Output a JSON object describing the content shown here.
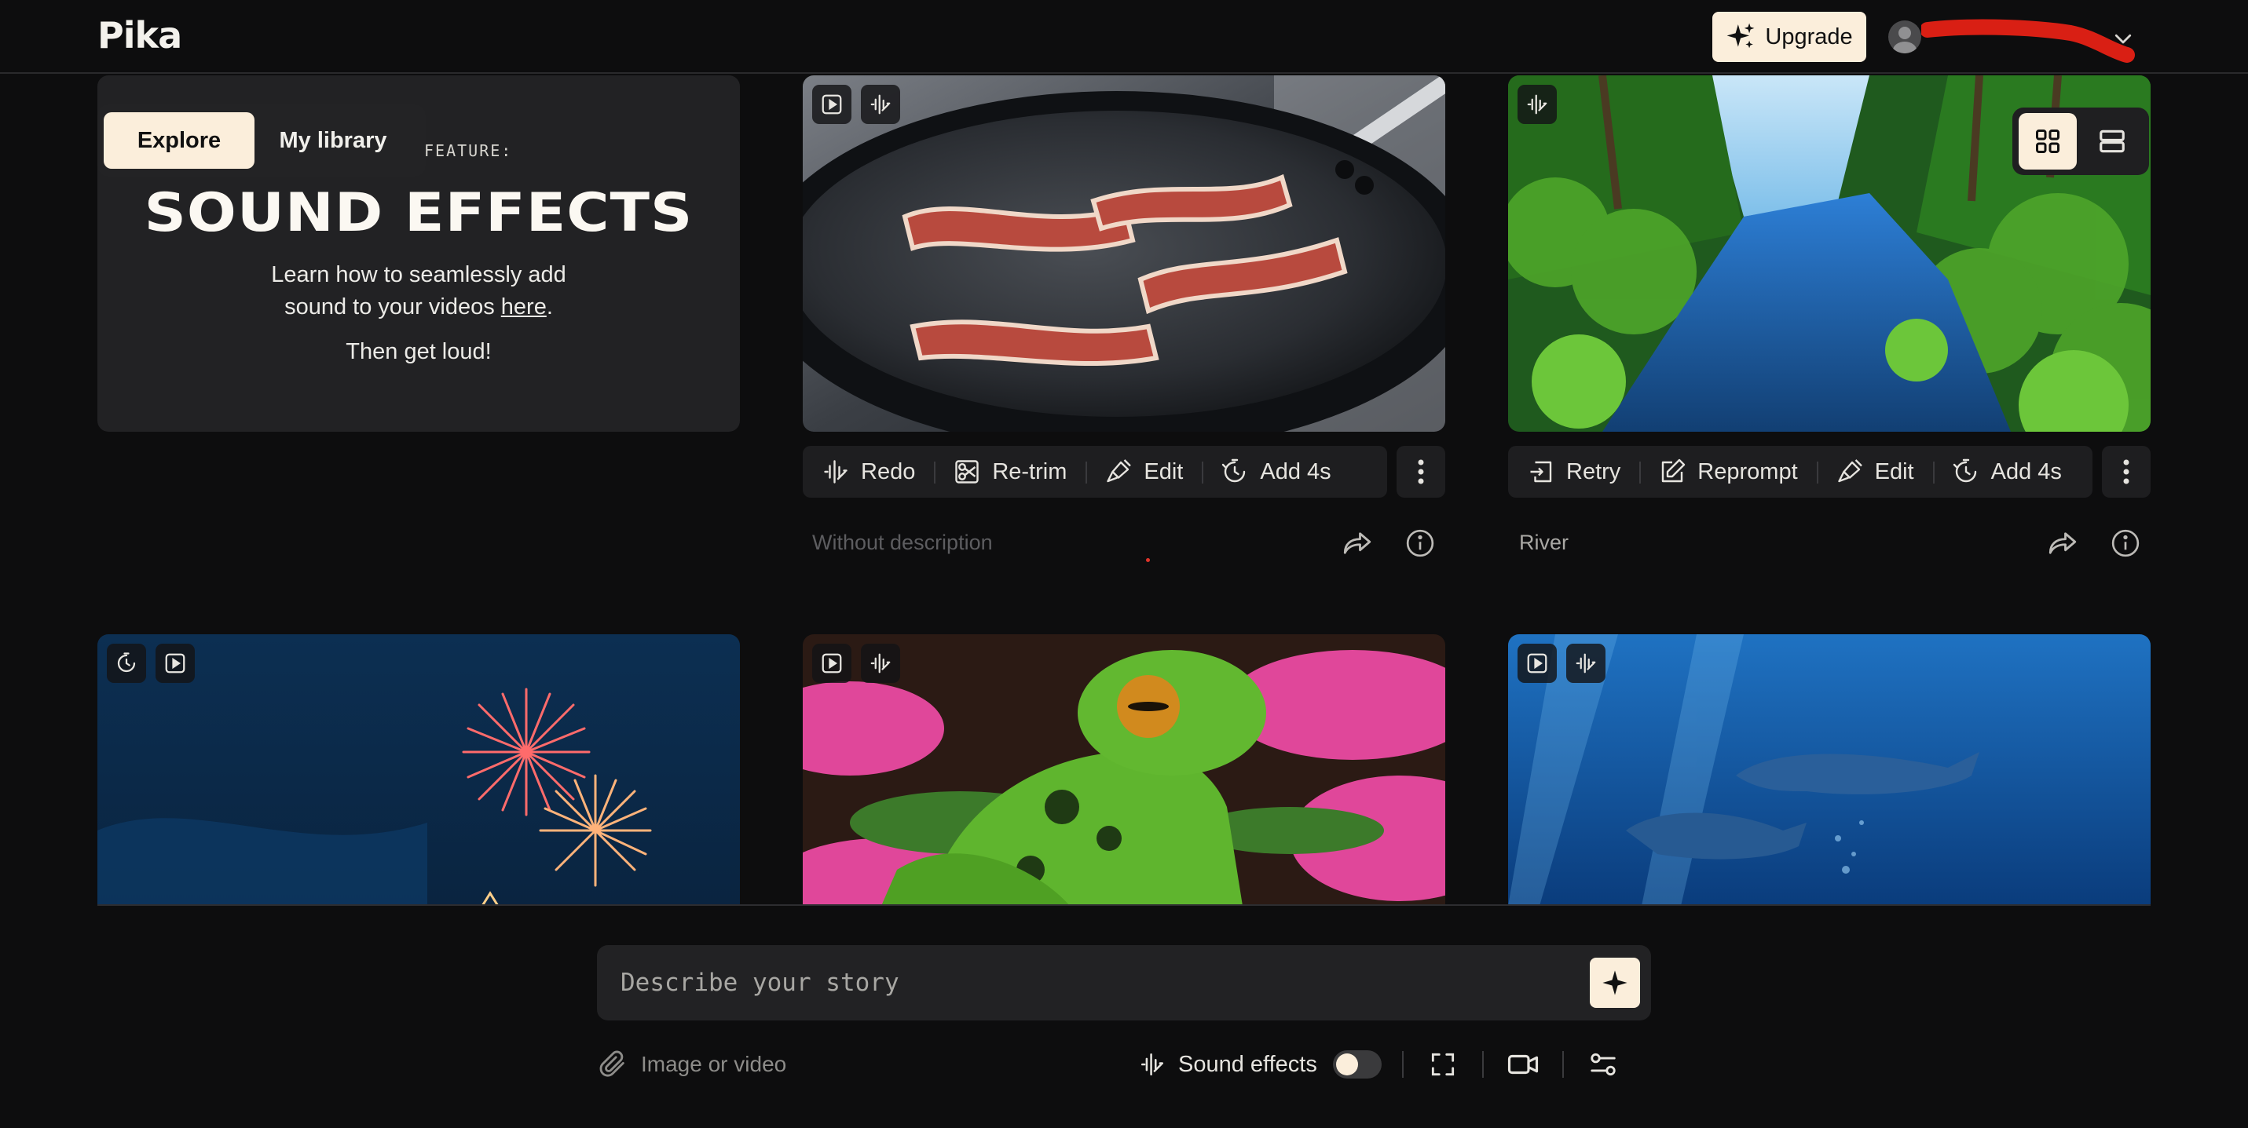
{
  "header": {
    "logo": "Pika",
    "upgrade_label": "Upgrade"
  },
  "tabs": [
    {
      "label": "Explore",
      "active": true
    },
    {
      "label": "My library",
      "active": false
    }
  ],
  "view_toggle": {
    "active": "grid"
  },
  "feature_card": {
    "kicker": "FEATURE:",
    "title": "SOUND EFFECTS",
    "body_line1": "Learn how to seamlessly add",
    "body_line2_prefix": "sound to your videos ",
    "body_link": "here",
    "body_line2_suffix": ".",
    "footer": "Then get loud!"
  },
  "cards": [
    {
      "id": "bacon",
      "badges": [
        "play-icon",
        "sound-wave-icon"
      ],
      "actions": [
        {
          "icon": "sound-wave-icon",
          "label": "Redo"
        },
        {
          "icon": "scissors-icon",
          "label": "Re-trim"
        },
        {
          "icon": "brush-icon",
          "label": "Edit"
        },
        {
          "icon": "timer-icon",
          "label": "Add 4s"
        }
      ],
      "description": "Without description"
    },
    {
      "id": "river",
      "badges": [
        "sound-wave-icon"
      ],
      "actions": [
        {
          "icon": "retry-icon",
          "label": "Retry"
        },
        {
          "icon": "pencil-square-icon",
          "label": "Reprompt"
        },
        {
          "icon": "brush-icon",
          "label": "Edit"
        },
        {
          "icon": "timer-icon",
          "label": "Add 4s"
        }
      ],
      "description": "River"
    },
    {
      "id": "fireworks",
      "badges": [
        "timer-icon",
        "play-icon"
      ]
    },
    {
      "id": "frog",
      "badges": [
        "play-icon",
        "sound-wave-icon"
      ]
    },
    {
      "id": "dolphins",
      "badges": [
        "play-icon",
        "sound-wave-icon"
      ]
    }
  ],
  "composer": {
    "placeholder": "Describe your story",
    "attach_label": "Image or video",
    "sound_effects_label": "Sound effects",
    "sound_effects_enabled": false
  },
  "colors": {
    "background": "#0d0d0e",
    "card": "#222224",
    "accent": "#fbeedb",
    "redaction": "#d91f14"
  }
}
